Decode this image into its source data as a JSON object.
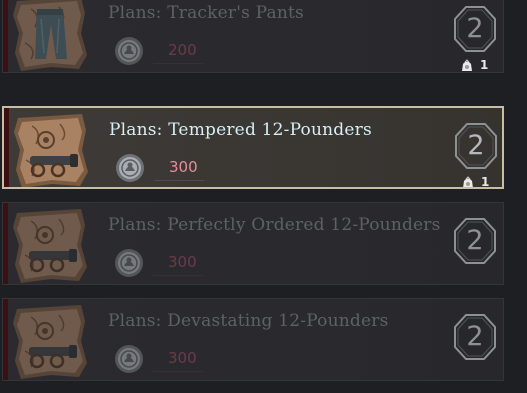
{
  "items": [
    {
      "title": "Plans: Tracker's Pants",
      "price": "200",
      "badge": "2",
      "owned": "1",
      "thumb_icon": "pants-plan-icon"
    },
    {
      "title": "Plans: Tempered 12-Pounders",
      "price": "300",
      "badge": "2",
      "owned": "1",
      "thumb_icon": "cannon-plan-icon"
    },
    {
      "title": "Plans: Perfectly Ordered 12-Pounders",
      "price": "300",
      "badge": "2",
      "owned": "",
      "thumb_icon": "cannon-plan-icon"
    },
    {
      "title": "Plans: Devastating 12-Pounders",
      "price": "300",
      "badge": "2",
      "owned": "",
      "thumb_icon": "cannon-plan-icon"
    }
  ],
  "currency_icon": "silver-coin-icon",
  "owned_icon": "bag-icon",
  "colors": {
    "selected_border": "#c8bea6",
    "price_active": "#e58e9a",
    "price_dim": "#6c3b45",
    "title_active": "#d6eef6",
    "title_dim": "#5d6166"
  }
}
